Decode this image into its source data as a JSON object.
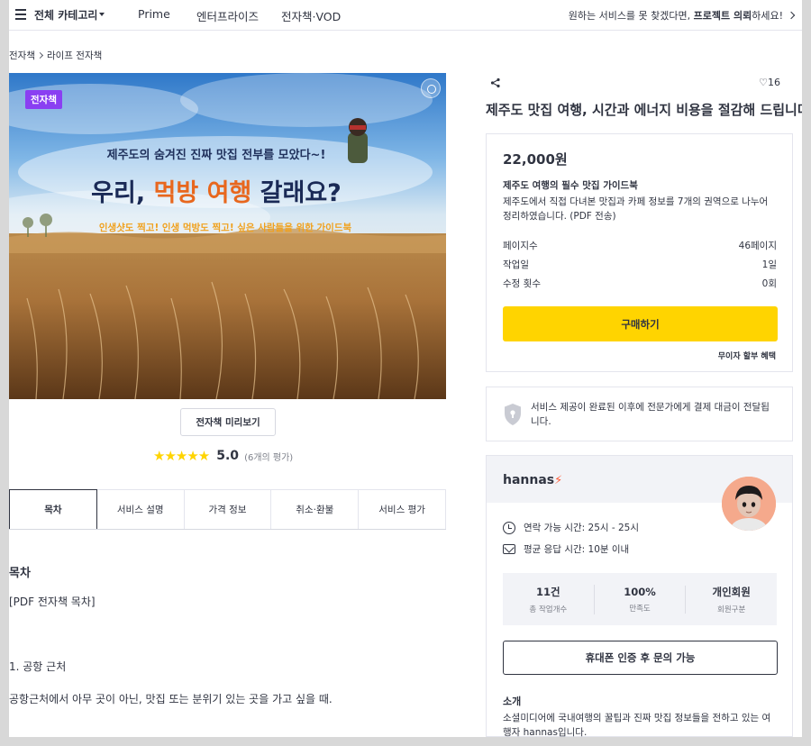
{
  "nav": {
    "category_label": "전체 카테고리",
    "links": [
      "Prime",
      "엔터프라이즈",
      "전자책·VOD"
    ],
    "promo_prefix": "원하는 서비스를 못 찾겠다면, ",
    "promo_bold": "프로젝트 의뢰",
    "promo_suffix": "하세요!"
  },
  "breadcrumb": [
    "전자책",
    "라이프 전자책"
  ],
  "hero": {
    "badge": "전자책",
    "caption_top": "제주도의 숨겨진 진짜 맛집 전부를 모았다~!",
    "headline_a": "우리, ",
    "headline_b": "먹방 여행",
    "headline_c": " 갈래요?",
    "caption_bottom": "인생샷도 찍고! 인생 먹방도 찍고! 싶은 사람들을 위한 가이드북"
  },
  "preview_button": "전자책 미리보기",
  "rating": {
    "stars": "★★★★★",
    "score": "5.0",
    "count": "(6개의 평가)"
  },
  "tabs": [
    {
      "label": "목차",
      "active": true
    },
    {
      "label": "서비스 설명",
      "active": false
    },
    {
      "label": "가격 정보",
      "active": false
    },
    {
      "label": "취소·환불",
      "active": false
    },
    {
      "label": "서비스 평가",
      "active": false
    }
  ],
  "content": {
    "title": "목차",
    "line1": "[PDF 전자책 목차]",
    "line2": "1. 공항 근처",
    "line3": "공항근처에서 아무 곳이 아닌, 맛집 또는 분위기 있는 곳을 가고 싶을 때."
  },
  "service": {
    "likes": "16",
    "title": "제주도 맛집 여행, 시간과 에너지 비용을 절감해 드립니다.",
    "price": "22,000원",
    "package_title": "제주도 여행의 필수 맛집 가이드북",
    "package_desc": "제주도에서 직접 다녀본 맛집과 카페 정보를 7개의 권역으로 나누어 정리하였습니다. (PDF 전송)",
    "specs": [
      {
        "label": "페이지수",
        "value": "46페이지"
      },
      {
        "label": "작업일",
        "value": "1일"
      },
      {
        "label": "수정 횟수",
        "value": "0회"
      }
    ],
    "buy_label": "구매하기",
    "interest_label": "무이자 할부 혜택"
  },
  "safe_notice": "서비스 제공이 완료된 이후에 전문가에게 결제 대금이 전달됩니다.",
  "expert": {
    "name": "hannas",
    "bolt": "⚡",
    "contact_time": "연락 가능 시간: 25시 - 25시",
    "response_time": "평균 응답 시간: 10분 이내",
    "stats": [
      {
        "value": "11건",
        "label": "총 작업개수"
      },
      {
        "value": "100%",
        "label": "만족도"
      },
      {
        "value": "개인회원",
        "label": "회원구분"
      }
    ],
    "contact_button": "휴대폰 인증 후 문의 가능",
    "intro_title": "소개",
    "intro_text": "소셜미디어에 국내여행의 꿀팁과 진짜 맛집 정보들을 전하고 있는 여행자 hannas입니다."
  },
  "colors": {
    "accent": "#ffd400",
    "badge": "#8a3ff2",
    "brand_bolt": "#ff5a36"
  }
}
